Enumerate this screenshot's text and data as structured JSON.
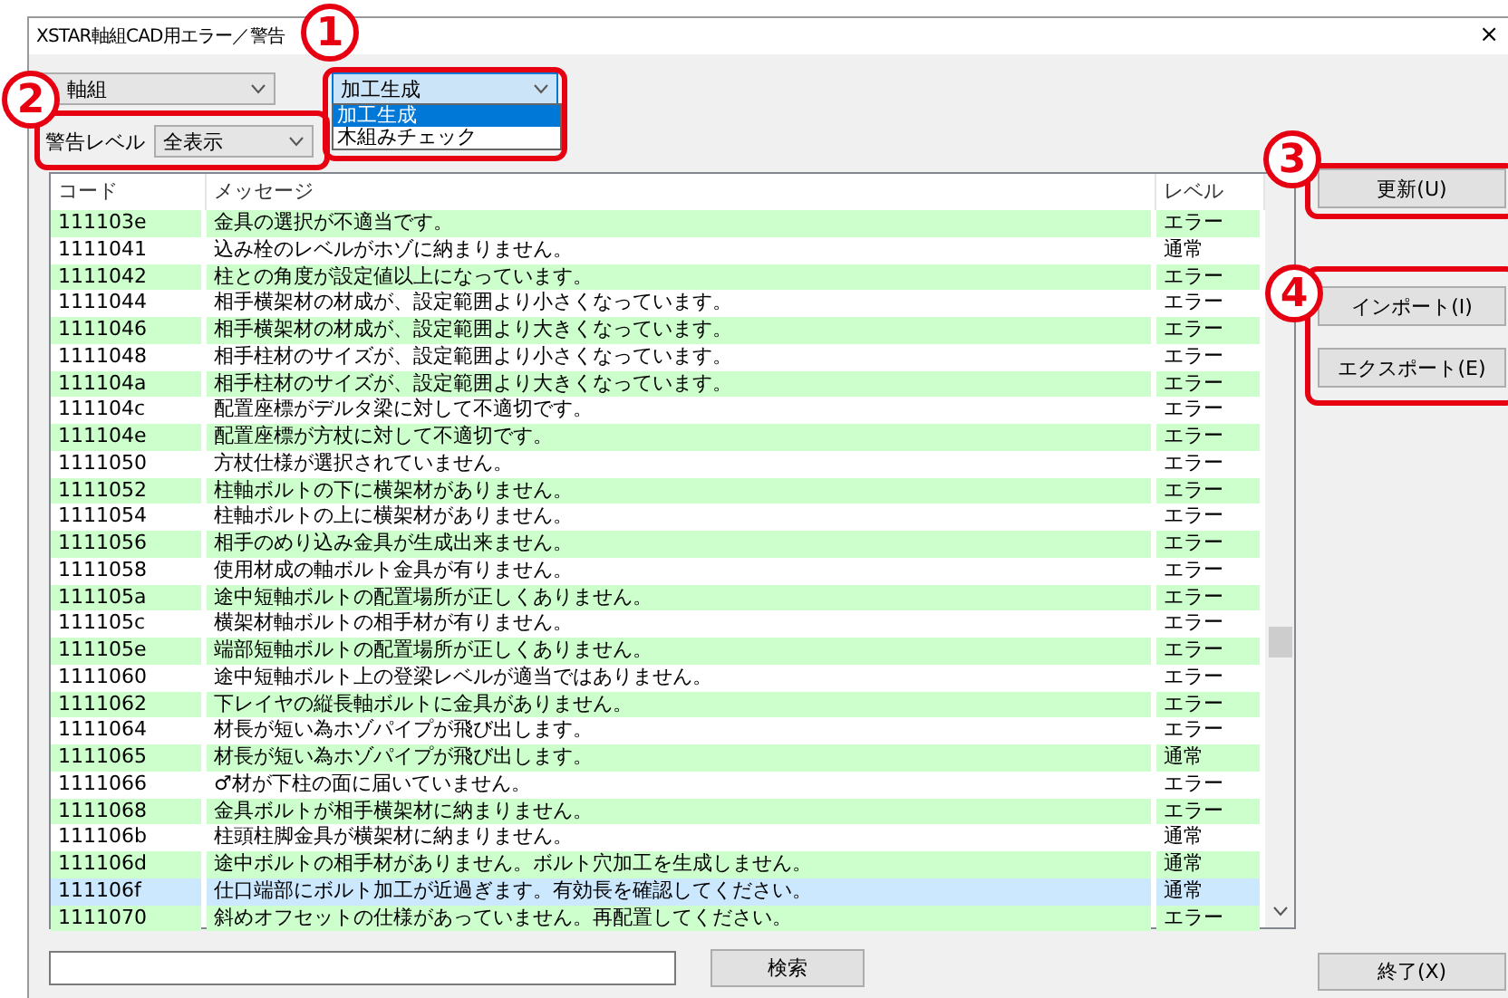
{
  "window": {
    "title": "XSTAR軸組CAD用エラー／警告",
    "close": "×"
  },
  "category_select": {
    "value": "軸組"
  },
  "mode_select": {
    "value": "加工生成",
    "expanded": true,
    "options": [
      {
        "label": "加工生成",
        "selected": true
      },
      {
        "label": "木組みチェック",
        "selected": false
      }
    ]
  },
  "level_filter": {
    "label": "警告レベル",
    "value": "全表示"
  },
  "table": {
    "columns": [
      "コード",
      "メッセージ",
      "レベル"
    ],
    "rows": [
      {
        "code": "111103e",
        "message": "金具の選択が不適当です。",
        "level": "エラー",
        "selected": false
      },
      {
        "code": "1111041",
        "message": "込み栓のレベルがホゾに納まりません。",
        "level": "通常",
        "selected": false
      },
      {
        "code": "1111042",
        "message": "柱との角度が設定値以上になっています。",
        "level": "エラー",
        "selected": false
      },
      {
        "code": "1111044",
        "message": "相手横架材の材成が、設定範囲より小さくなっています。",
        "level": "エラー",
        "selected": false
      },
      {
        "code": "1111046",
        "message": "相手横架材の材成が、設定範囲より大きくなっています。",
        "level": "エラー",
        "selected": false
      },
      {
        "code": "1111048",
        "message": "相手柱材のサイズが、設定範囲より小さくなっています。",
        "level": "エラー",
        "selected": false
      },
      {
        "code": "111104a",
        "message": "相手柱材のサイズが、設定範囲より大きくなっています。",
        "level": "エラー",
        "selected": false
      },
      {
        "code": "111104c",
        "message": "配置座標がデルタ梁に対して不適切です。",
        "level": "エラー",
        "selected": false
      },
      {
        "code": "111104e",
        "message": "配置座標が方杖に対して不適切です。",
        "level": "エラー",
        "selected": false
      },
      {
        "code": "1111050",
        "message": "方杖仕様が選択されていません。",
        "level": "エラー",
        "selected": false
      },
      {
        "code": "1111052",
        "message": "柱軸ボルトの下に横架材がありません。",
        "level": "エラー",
        "selected": false
      },
      {
        "code": "1111054",
        "message": "柱軸ボルトの上に横架材がありません。",
        "level": "エラー",
        "selected": false
      },
      {
        "code": "1111056",
        "message": "相手のめり込み金具が生成出来ません。",
        "level": "エラー",
        "selected": false
      },
      {
        "code": "1111058",
        "message": "使用材成の軸ボルト金具が有りません。",
        "level": "エラー",
        "selected": false
      },
      {
        "code": "111105a",
        "message": "途中短軸ボルトの配置場所が正しくありません。",
        "level": "エラー",
        "selected": false
      },
      {
        "code": "111105c",
        "message": "横架材軸ボルトの相手材が有りません。",
        "level": "エラー",
        "selected": false
      },
      {
        "code": "111105e",
        "message": "端部短軸ボルトの配置場所が正しくありません。",
        "level": "エラー",
        "selected": false
      },
      {
        "code": "1111060",
        "message": "途中短軸ボルト上の登梁レベルが適当ではありません。",
        "level": "エラー",
        "selected": false
      },
      {
        "code": "1111062",
        "message": "下レイヤの縦長軸ボルトに金具がありません。",
        "level": "エラー",
        "selected": false
      },
      {
        "code": "1111064",
        "message": "材長が短い為ホゾパイプが飛び出します。",
        "level": "エラー",
        "selected": false
      },
      {
        "code": "1111065",
        "message": "材長が短い為ホゾパイプが飛び出します。",
        "level": "通常",
        "selected": false
      },
      {
        "code": "1111066",
        "message": "♂材が下柱の面に届いていません。",
        "level": "エラー",
        "selected": false
      },
      {
        "code": "1111068",
        "message": "金具ボルトが相手横架材に納まりません。",
        "level": "エラー",
        "selected": false
      },
      {
        "code": "111106b",
        "message": "柱頭柱脚金具が横架材に納まりません。",
        "level": "通常",
        "selected": false
      },
      {
        "code": "111106d",
        "message": "途中ボルトの相手材がありません。ボルト穴加工を生成しません。",
        "level": "通常",
        "selected": false
      },
      {
        "code": "111106f",
        "message": "仕口端部にボルト加工が近過ぎます。有効長を確認してください。",
        "level": "通常",
        "selected": true
      },
      {
        "code": "1111070",
        "message": "斜めオフセットの仕様があっていません。再配置してください。",
        "level": "エラー",
        "selected": false
      }
    ]
  },
  "side_buttons": [
    {
      "label": "更新(U)"
    },
    {
      "label": "インポート(I)"
    },
    {
      "label": "エクスポート(E)"
    }
  ],
  "search": {
    "button": "検索"
  },
  "close_button": {
    "label": "終了(X)"
  },
  "annotations": [
    {
      "number": "1"
    },
    {
      "number": "2"
    },
    {
      "number": "3"
    },
    {
      "number": "4"
    }
  ]
}
